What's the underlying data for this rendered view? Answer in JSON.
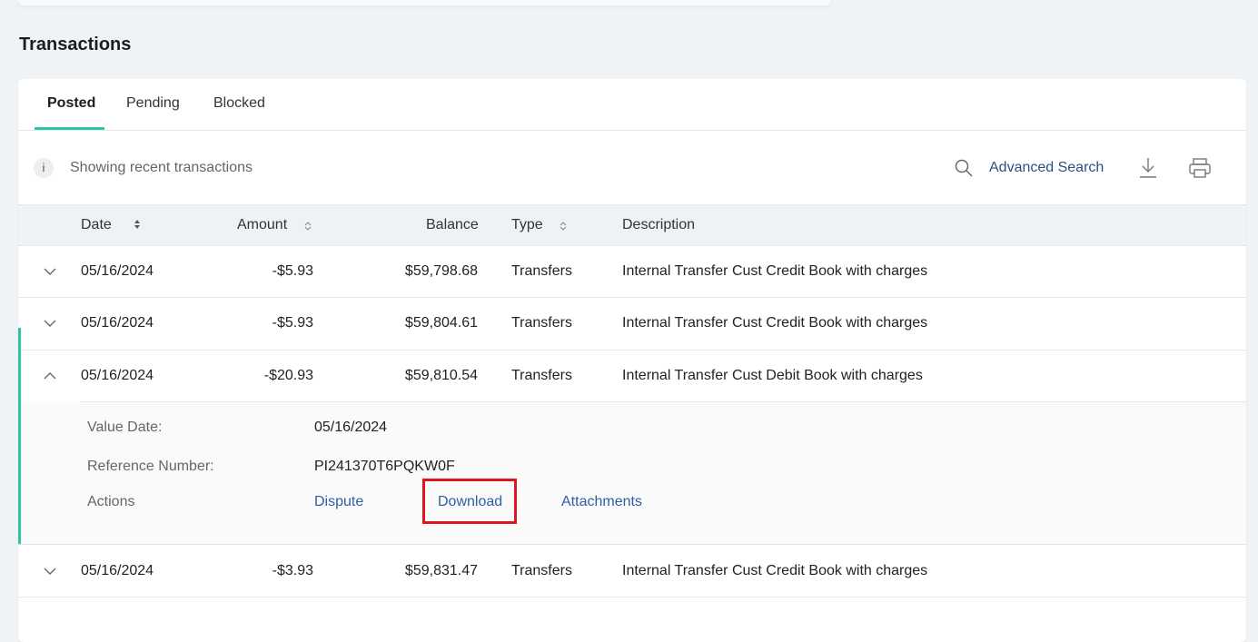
{
  "page": {
    "title": "Transactions"
  },
  "tabs": [
    {
      "label": "Posted",
      "active": true
    },
    {
      "label": "Pending",
      "active": false
    },
    {
      "label": "Blocked",
      "active": false
    }
  ],
  "info": {
    "icon_label": "i",
    "text": "Showing recent transactions"
  },
  "toolbar": {
    "search_icon": "search-icon",
    "advanced_search_label": "Advanced Search",
    "download_icon": "download-icon",
    "print_icon": "print-icon"
  },
  "table": {
    "columns": [
      "Date",
      "Amount",
      "Balance",
      "Type",
      "Description"
    ],
    "rows": [
      {
        "date": "05/16/2024",
        "amount": "-$5.93",
        "balance": "$59,798.68",
        "type": "Transfers",
        "description": "Internal Transfer Cust Credit Book with charges",
        "expanded": false
      },
      {
        "date": "05/16/2024",
        "amount": "-$5.93",
        "balance": "$59,804.61",
        "type": "Transfers",
        "description": "Internal Transfer Cust Credit Book with charges",
        "expanded": false
      },
      {
        "date": "05/16/2024",
        "amount": "-$20.93",
        "balance": "$59,810.54",
        "type": "Transfers",
        "description": "Internal Transfer Cust Debit Book with charges",
        "expanded": true
      },
      {
        "date": "05/16/2024",
        "amount": "-$3.93",
        "balance": "$59,831.47",
        "type": "Transfers",
        "description": "Internal Transfer Cust Credit Book with charges",
        "expanded": false
      }
    ]
  },
  "detail": {
    "value_date_label": "Value Date:",
    "value_date": "05/16/2024",
    "reference_label": "Reference Number:",
    "reference": "PI241370T6PQKW0F",
    "actions_label": "Actions",
    "actions": [
      "Dispute",
      "Download",
      "Attachments"
    ]
  },
  "colors": {
    "accent": "#2ec4a5",
    "link": "#2d5fa8",
    "highlight": "#e0161e"
  }
}
